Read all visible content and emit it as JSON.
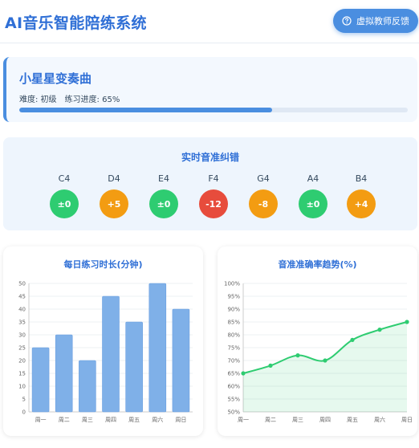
{
  "header": {
    "title": "AI音乐智能陪练系统",
    "feedback_button": "虚拟教师反馈",
    "feedback_icon": "question-circle-icon"
  },
  "song": {
    "title": "小星星变奏曲",
    "difficulty": "难度: 初级",
    "progress_text": "练习进度: 65%",
    "progress": 0.65
  },
  "pitch": {
    "title": "实时音准纠错",
    "notes": [
      {
        "name": "C4",
        "value": "±0",
        "status": "good"
      },
      {
        "name": "D4",
        "value": "+5",
        "status": "warn"
      },
      {
        "name": "E4",
        "value": "±0",
        "status": "good"
      },
      {
        "name": "F4",
        "value": "-12",
        "status": "bad"
      },
      {
        "name": "G4",
        "value": "-8",
        "status": "warn"
      },
      {
        "name": "A4",
        "value": "±0",
        "status": "good"
      },
      {
        "name": "B4",
        "value": "+4",
        "status": "warn"
      }
    ],
    "colors": {
      "good": "#2ecc71",
      "warn": "#f39c12",
      "bad": "#e74c3c"
    }
  },
  "chart_data": [
    {
      "type": "bar",
      "title": "每日练习时长(分钟)",
      "categories": [
        "周一",
        "周二",
        "周三",
        "周四",
        "周五",
        "周六",
        "周日"
      ],
      "values": [
        25,
        30,
        20,
        45,
        35,
        50,
        40
      ],
      "ylim": [
        0,
        50
      ],
      "yticks": [
        "0",
        "5",
        "10",
        "15",
        "20",
        "25",
        "30",
        "35",
        "40",
        "45",
        "50"
      ],
      "color": "#7fb0e8",
      "grid": true
    },
    {
      "type": "area",
      "title": "音准准确率趋势(%)",
      "categories": [
        "周一",
        "周二",
        "周三",
        "周四",
        "周五",
        "周六",
        "周日"
      ],
      "values": [
        65,
        68,
        72,
        70,
        78,
        82,
        85
      ],
      "ylim": [
        50,
        100
      ],
      "yticks": [
        "50%",
        "55%",
        "60%",
        "65%",
        "70%",
        "75%",
        "80%",
        "85%",
        "90%",
        "95%",
        "100%"
      ],
      "color": "#2ecc71",
      "grid": true
    }
  ]
}
